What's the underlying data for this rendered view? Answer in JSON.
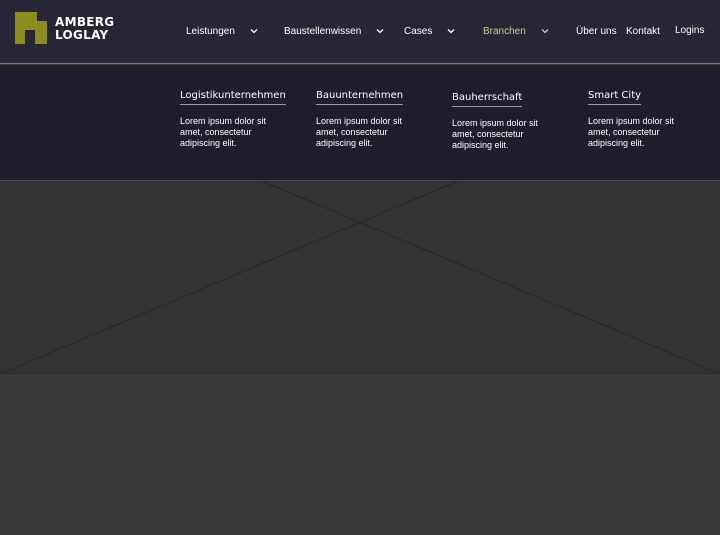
{
  "brand": {
    "line1": "AMBERG",
    "line2": "LOGLAY",
    "accent_color": "#8c8c1f"
  },
  "nav": {
    "items": [
      {
        "label": "Leistungen",
        "has_dropdown": true
      },
      {
        "label": "Baustellenwissen",
        "has_dropdown": true
      },
      {
        "label": "Cases",
        "has_dropdown": true
      },
      {
        "label": "Branchen",
        "has_dropdown": true,
        "active": true
      },
      {
        "label": "Über uns",
        "has_dropdown": false
      },
      {
        "label": "Kontakt",
        "has_dropdown": false
      },
      {
        "label": "Logins",
        "has_dropdown": false
      }
    ],
    "active_color": "#c9d07a"
  },
  "mega_menu": {
    "columns": [
      {
        "title": "Logistikunternehmen",
        "description": "Lorem ipsum dolor sit amet, consectetur adipiscing elit."
      },
      {
        "title": "Bauunternehmen",
        "description": "Lorem ipsum dolor sit amet, consectetur adipiscing elit."
      },
      {
        "title": "Bauherrschaft",
        "description": "Lorem ipsum dolor sit amet, consectetur adipiscing elit."
      },
      {
        "title": "Smart City",
        "description": "Lorem ipsum dolor sit amet, consectetur adipiscing elit."
      }
    ]
  }
}
